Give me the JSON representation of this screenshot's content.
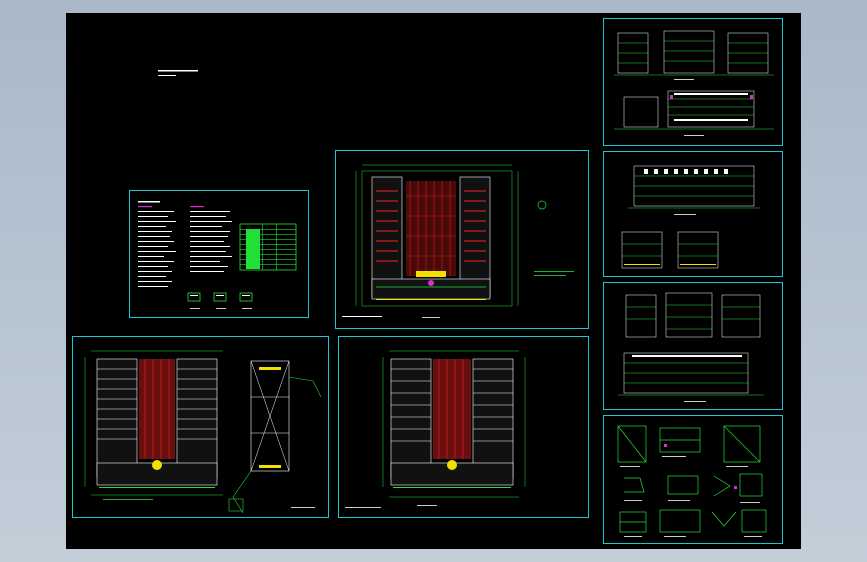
{
  "colors": {
    "background": "#000000",
    "sheet_border": "#19c8d2",
    "green": "#22e03a",
    "red": "#c82020",
    "white": "#ffffff",
    "yellow": "#f2e000",
    "magenta": "#e02ad0"
  },
  "sheets": [
    {
      "id": "design-notes",
      "kind": "notes"
    },
    {
      "id": "site-plan",
      "kind": "plan"
    },
    {
      "id": "floor-plan-stair",
      "kind": "plan-with-detail"
    },
    {
      "id": "floor-plan-typical",
      "kind": "plan"
    },
    {
      "id": "elevations-1",
      "kind": "elevation"
    },
    {
      "id": "elevations-2",
      "kind": "elevation"
    },
    {
      "id": "elevations-3",
      "kind": "elevation"
    },
    {
      "id": "details",
      "kind": "detail"
    }
  ]
}
